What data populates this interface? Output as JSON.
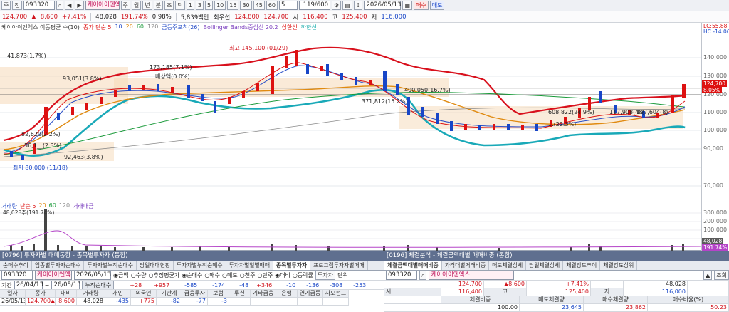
{
  "toolbar": {
    "code_prefix": "주",
    "price_type": "전",
    "code": "093320",
    "name": "케이아이엔엑",
    "periods": [
      "주",
      "월",
      "년",
      "분",
      "초",
      "틱"
    ],
    "minute_steps": [
      "1",
      "3",
      "5",
      "10",
      "15",
      "30",
      "45",
      "60"
    ],
    "step": "5",
    "count": "119/600",
    "date": "2026/05/13",
    "buy_label": "매수",
    "sell_label": "매도"
  },
  "quote": {
    "price": "124,700",
    "change": "8,600",
    "change_pct": "+7.41%",
    "volume": "48,028",
    "vol_ratio": "191.74%",
    "turnover": "0.98%",
    "amount": "5,839백만",
    "best_bid_label": "최우선",
    "best_bid": "124,800",
    "best_ask": "124,700",
    "open_label": "시",
    "open": "116,400",
    "high_label": "고",
    "high": "125,400",
    "low_label": "저",
    "low": "116,000"
  },
  "chart": {
    "title": "케이아이엔엑스 이동평균 수(10)",
    "legend": [
      {
        "text": "종가 단순 5",
        "color": "#d11"
      },
      {
        "text": "10",
        "color": "#2a50c8"
      },
      {
        "text": "20",
        "color": "#e08a10"
      },
      {
        "text": "60",
        "color": "#1a9a3a"
      },
      {
        "text": "120",
        "color": "#888"
      },
      {
        "text": "금등주포착(26)",
        "color": "#2a50c8"
      },
      {
        "text": "Bollinger Bands중심선 20.2",
        "color": "#7a3fbf"
      },
      {
        "text": "상한선",
        "color": "#d11"
      },
      {
        "text": "하한선",
        "color": "#1aa"
      }
    ],
    "corner_top": "LC:55.88",
    "corner_bottom": "HC:-14.06",
    "y_axis": [
      "140,000",
      "130,000",
      "120,000",
      "110,000",
      "100,000",
      "90,000",
      "80,000",
      "70,000"
    ],
    "price_tag": "124,700",
    "price_tag_pct": "8.05%",
    "annotations": [
      {
        "text": "41,873(1.7%)"
      },
      {
        "text": "93,051(3.8%)"
      },
      {
        "text": "173,185(7.1%)"
      },
      {
        "text": "배상액(0.0%)"
      },
      {
        "text": "최고 145,100 (01/29)"
      },
      {
        "text": "400,050(16.7%)"
      },
      {
        "text": "371,812(15.2%)"
      },
      {
        "text": "52,620(2.2%)"
      },
      {
        "text": "56,1__(2.3%)"
      },
      {
        "text": "92,463(3.8%)"
      },
      {
        "text": "최저 80,000 (11/18)"
      },
      {
        "text": "608,822(24.9%)"
      },
      {
        "text": "117,908(48)"
      },
      {
        "text": "197,604(8)"
      },
      {
        "text": "...(22.3%)"
      }
    ]
  },
  "volume_chart": {
    "title_parts": [
      "거래량",
      "단순 5",
      "20",
      "60",
      "120",
      "거래대금"
    ],
    "current": "48,028주(191.74%)",
    "y_axis": [
      "300,000",
      "250,000",
      "200,000",
      "150,000",
      "100,000",
      "50,000"
    ],
    "tag_volume": "48,028",
    "tag_pct": "191.74%"
  },
  "left_window": {
    "title": "[0796] 투자자별 매매동향 - 종목별투자자 (통합)",
    "tabs": [
      "순매수추이",
      "업종별투자자순매수",
      "투자자별누적순매수",
      "당일매매현황",
      "투자자별누적순매수",
      "투자자별일별매매",
      "종목별투자자",
      "프로그램투자자별매매"
    ],
    "active_tab": 6,
    "code": "093320",
    "name": "케이아이엔엑스",
    "date": "2026/05/13",
    "radios": [
      "금액",
      "수량",
      "추정평균가",
      "순매수",
      "매수",
      "매도",
      "천주",
      "단주",
      "대비",
      "등락률",
      "투자자"
    ],
    "unit_label": "단위",
    "period_label": "기간",
    "from": "26/04/13",
    "to": "26/05/13",
    "cum_label": "누적순매수",
    "cum_values": [
      "+28",
      "+957",
      "-585",
      "-174",
      "-48",
      "+346",
      "-10",
      "-136",
      "-308",
      "-253"
    ],
    "headers": [
      "일자",
      "종가",
      "대비",
      "거래량",
      "개인",
      "외국인",
      "기관계",
      "금융투자",
      "보험",
      "투신",
      "기타금융",
      "은행",
      "연기금등",
      "사모펀드"
    ],
    "row": [
      "26/05/13",
      "124,700▲",
      "8,600",
      "48,028",
      "-435",
      "+775",
      "-82",
      "-77",
      "-3",
      "",
      "",
      "",
      "",
      ""
    ]
  },
  "right_window": {
    "title": "[0196] 체결분석 - 체결금액대별 매매비중 (통합)",
    "tabs": [
      "체결금액대별매매비중",
      "가격대별거래비중",
      "매도체결상세",
      "당일체결상세",
      "체결강도추이",
      "체결강도상위"
    ],
    "active_tab": 0,
    "code": "093320",
    "name": "케이아이엔엑스",
    "query_label": "조회",
    "price": "124,700",
    "change": "8,600",
    "change_pct": "+7.41%",
    "volume": "48,028",
    "open_label": "시",
    "open": "116,400",
    "high_label": "고",
    "high": "125,400",
    "low_label": "저",
    "low": "116,000",
    "headers": [
      "체결비중",
      "매도체결량",
      "매수체결량",
      "매수비율(%)"
    ],
    "values": [
      "100.00",
      "23,645",
      "23,862",
      "50.23"
    ]
  }
}
